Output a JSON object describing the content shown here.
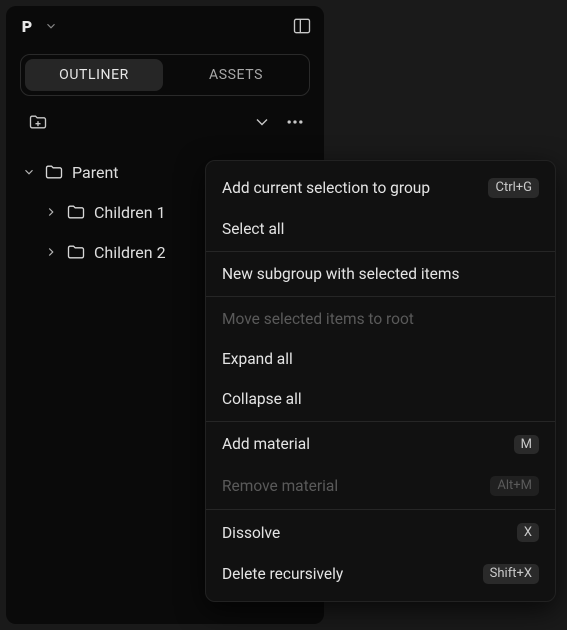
{
  "header": {
    "logo_letter": "P"
  },
  "tabs": {
    "outliner": "OUTLINER",
    "assets": "ASSETS"
  },
  "tree": {
    "parent": "Parent",
    "children": [
      "Children 1",
      "Children 2"
    ]
  },
  "context_menu": [
    {
      "label": "Add current selection to group",
      "shortcut": "Ctrl+G",
      "enabled": true,
      "sep_after": false
    },
    {
      "label": "Select all",
      "shortcut": null,
      "enabled": true,
      "sep_after": true
    },
    {
      "label": "New subgroup with selected items",
      "shortcut": null,
      "enabled": true,
      "sep_after": true
    },
    {
      "label": "Move selected items to root",
      "shortcut": null,
      "enabled": false,
      "sep_after": false
    },
    {
      "label": "Expand all",
      "shortcut": null,
      "enabled": true,
      "sep_after": false
    },
    {
      "label": "Collapse all",
      "shortcut": null,
      "enabled": true,
      "sep_after": true
    },
    {
      "label": "Add material",
      "shortcut": "M",
      "enabled": true,
      "sep_after": false
    },
    {
      "label": "Remove material",
      "shortcut": "Alt+M",
      "enabled": false,
      "sep_after": true
    },
    {
      "label": "Dissolve",
      "shortcut": "X",
      "enabled": true,
      "sep_after": false
    },
    {
      "label": "Delete recursively",
      "shortcut": "Shift+X",
      "enabled": true,
      "sep_after": false
    }
  ]
}
